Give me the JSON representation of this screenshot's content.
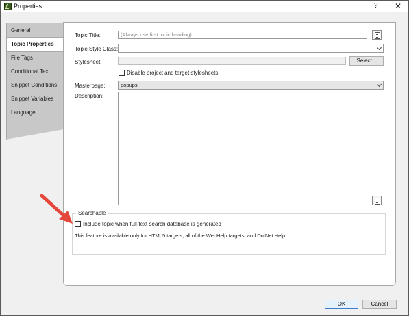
{
  "window": {
    "title": "Properties",
    "help": "?",
    "close": "✕"
  },
  "tabs": [
    {
      "label": "General"
    },
    {
      "label": "Topic Properties"
    },
    {
      "label": "File Tags"
    },
    {
      "label": "Conditional Text"
    },
    {
      "label": "Snippet Conditions"
    },
    {
      "label": "Snippet Variables"
    },
    {
      "label": "Language"
    }
  ],
  "form": {
    "topic_title_label": "Topic Title:",
    "topic_title_placeholder": "(Always use first topic heading)",
    "topic_style_class_label": "Topic Style Class:",
    "topic_style_class_value": "",
    "stylesheet_label": "Stylesheet:",
    "stylesheet_value": "",
    "select_button": "Select...",
    "disable_stylesheets_label": "Disable project and target stylesheets",
    "masterpage_label": "Masterpage:",
    "masterpage_value": "popups",
    "description_label": "Description:",
    "description_value": ""
  },
  "searchable": {
    "title": "Searchable",
    "include_label": "Include topic when full-text search database is generated",
    "note": "This feature is available only for HTML5 targets, all of the WebHelp targets, and DotNet Help."
  },
  "footer": {
    "ok": "OK",
    "cancel": "Cancel"
  },
  "colors": {
    "annotation_arrow": "#e5473a",
    "active_tab": "#ffffff",
    "inactive_tabs": "#c8c8c8"
  }
}
